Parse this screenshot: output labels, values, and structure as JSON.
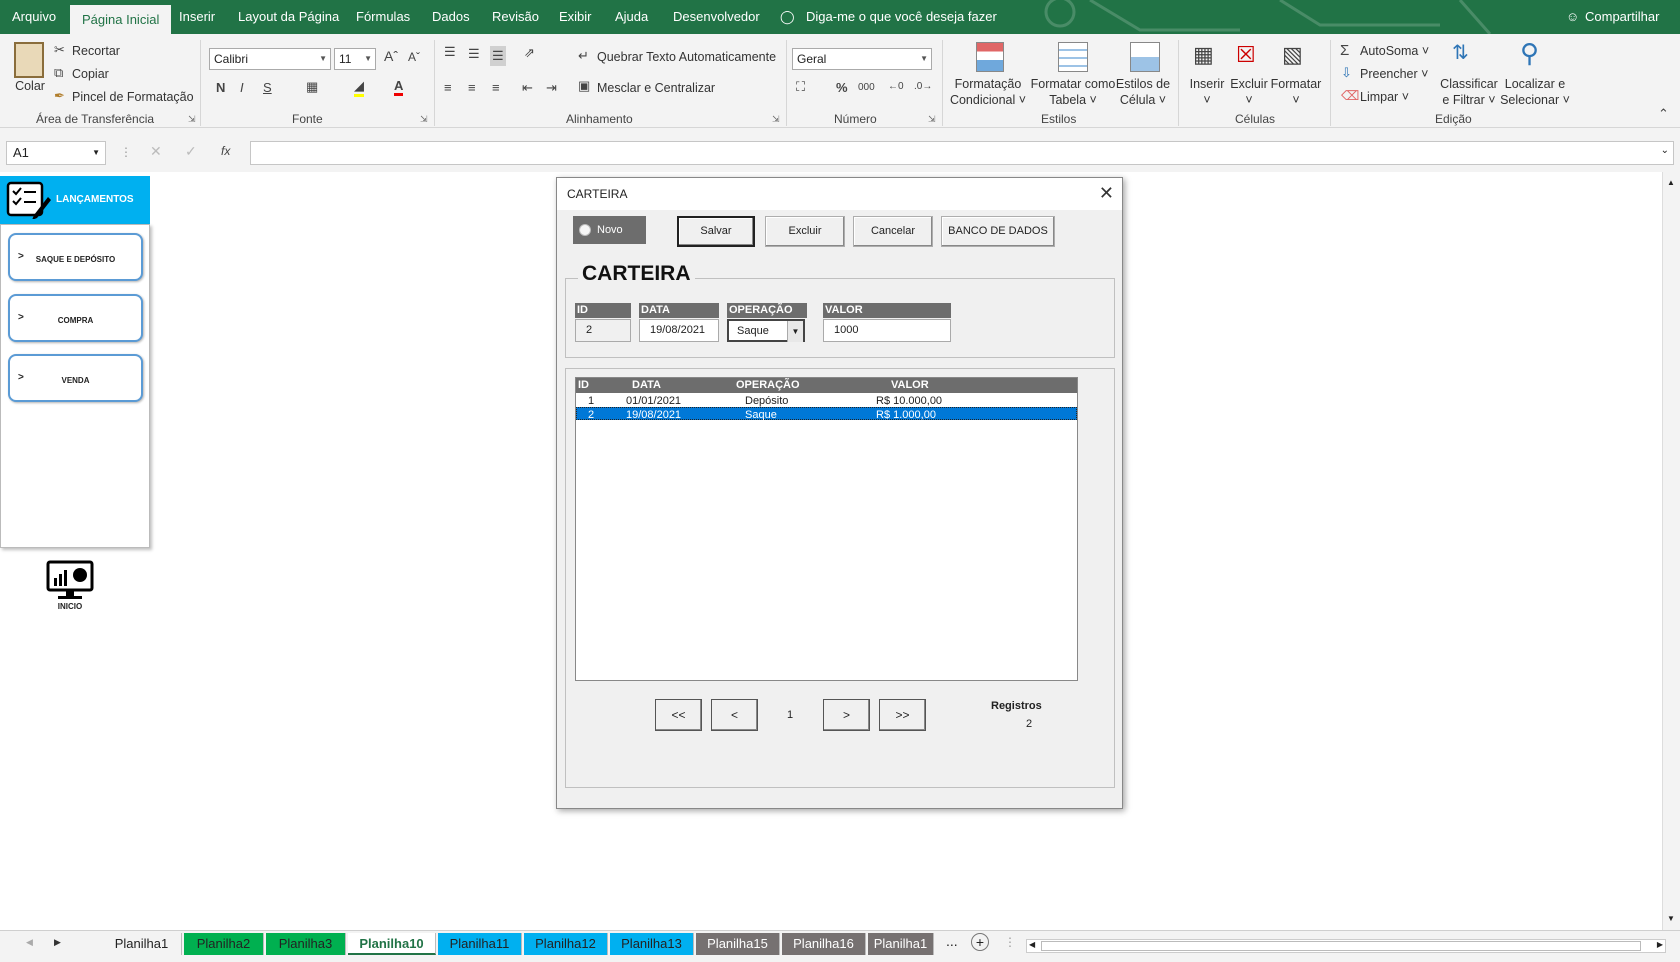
{
  "menu": {
    "items": [
      "Arquivo",
      "Página Inicial",
      "Inserir",
      "Layout da Página",
      "Fórmulas",
      "Dados",
      "Revisão",
      "Exibir",
      "Ajuda",
      "Desenvolvedor"
    ],
    "tell_me": "Diga-me o que você deseja fazer",
    "share": "Compartilhar"
  },
  "ribbon": {
    "clipboard": {
      "paste": "Colar",
      "cut": "Recortar",
      "copy": "Copiar",
      "format_painter": "Pincel de Formatação",
      "label": "Área de Transferência"
    },
    "font": {
      "name": "Calibri",
      "size": "11",
      "bold": "N",
      "italic": "I",
      "underline": "S",
      "label": "Fonte"
    },
    "alignment": {
      "wrap": "Quebrar Texto Automaticamente",
      "merge": "Mesclar e Centralizar",
      "label": "Alinhamento"
    },
    "number": {
      "format": "Geral",
      "label": "Número"
    },
    "styles": {
      "conditional": [
        "Formatação",
        "Condicional"
      ],
      "as_table": [
        "Formatar como",
        "Tabela"
      ],
      "cell_styles": [
        "Estilos de",
        "Célula"
      ],
      "label": "Estilos"
    },
    "cells": {
      "insert": "Inserir",
      "delete": "Excluir",
      "format": "Formatar",
      "label": "Células"
    },
    "editing": {
      "autosum": "AutoSoma",
      "fill": "Preencher",
      "clear": "Limpar",
      "sort": [
        "Classificar",
        "e Filtrar"
      ],
      "find": [
        "Localizar e",
        "Selecionar"
      ],
      "label": "Edição"
    }
  },
  "formula_bar": {
    "name_box": "A1",
    "fx": "fx",
    "value": ""
  },
  "sheet_panel": {
    "header": "LANÇAMENTOS",
    "buttons": [
      "SAQUE E DEPÓSITO",
      "COMPRA",
      "VENDA"
    ],
    "arrow": ">",
    "inicio": "INICIO"
  },
  "dialog": {
    "title": "CARTEIRA",
    "close": "✕",
    "novo": "Novo",
    "buttons": {
      "save": "Salvar",
      "delete": "Excluir",
      "cancel": "Cancelar",
      "db": "BANCO DE DADOS"
    },
    "frame_title": "CARTEIRA",
    "fields": {
      "id": {
        "label": "ID",
        "value": "2"
      },
      "data": {
        "label": "DATA",
        "value": "19/08/2021"
      },
      "operacao": {
        "label": "OPERAÇÃO",
        "value": "Saque"
      },
      "valor": {
        "label": "VALOR",
        "value": "1000"
      }
    },
    "grid": {
      "headers": [
        "ID",
        "DATA",
        "OPERAÇÃO",
        "VALOR"
      ],
      "rows": [
        [
          "1",
          "01/01/2021",
          "Depósito",
          "R$ 10.000,00"
        ],
        [
          "2",
          "19/08/2021",
          "Saque",
          "R$ 1.000,00"
        ]
      ],
      "selected_row": 1
    },
    "nav": {
      "first": "<<",
      "prev": "<",
      "page": "1",
      "next": ">",
      "last": ">>"
    },
    "records": {
      "label": "Registros",
      "value": "2"
    }
  },
  "sheet_tabs": {
    "tabs": [
      {
        "name": "Planilha1",
        "color": "#f3f3f3"
      },
      {
        "name": "Planilha2",
        "color": "#00b050"
      },
      {
        "name": "Planilha3",
        "color": "#00b050"
      },
      {
        "name": "Planilha10",
        "color": "#ffffff",
        "active": true
      },
      {
        "name": "Planilha11",
        "color": "#00b0f0"
      },
      {
        "name": "Planilha12",
        "color": "#00b0f0"
      },
      {
        "name": "Planilha13",
        "color": "#00b0f0"
      },
      {
        "name": "Planilha15",
        "color": "#767171"
      },
      {
        "name": "Planilha16",
        "color": "#767171"
      },
      {
        "name": "Planilha1",
        "color": "#767171"
      }
    ],
    "more": "...",
    "add": "+"
  },
  "colors": {
    "excel_green": "#217346",
    "header_blue": "#00b0f0",
    "selection": "#0078d7",
    "grid_header": "#6d6d6d"
  }
}
